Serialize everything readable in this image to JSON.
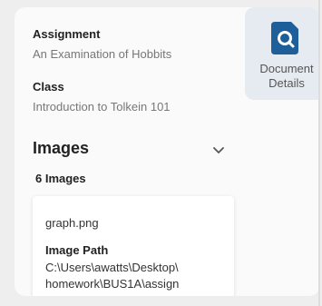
{
  "assignment": {
    "label": "Assignment",
    "value": "An Examination of Hobbits"
  },
  "class_info": {
    "label": "Class",
    "value": "Introduction to Tolkein 101"
  },
  "document_details": {
    "label_line1": "Document",
    "label_line2": "Details",
    "icon": "document-search-icon",
    "accent_color": "#1e5f99"
  },
  "images_section": {
    "title": "Images",
    "count": "6 Images",
    "expand_icon": "chevron-down-icon"
  },
  "image_card": {
    "file_name": "graph.png",
    "path_label": "Image Path",
    "path_line1": "C:\\Users\\awatts\\Desktop\\",
    "path_line2": "homework\\BUS1A\\assign"
  }
}
